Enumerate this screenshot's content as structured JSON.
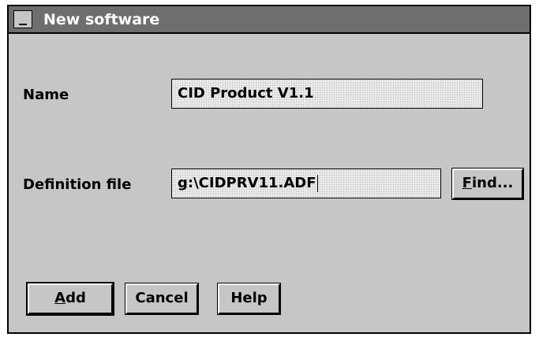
{
  "window": {
    "title": "New software",
    "sysmenu_glyph": "⌄"
  },
  "form": {
    "name_label": "Name",
    "name_value": "CID Product V1.1",
    "definition_label": "Definition file",
    "definition_value": "g:\\CIDPRV11.ADF"
  },
  "buttons": {
    "find_mnemonic": "F",
    "find_rest": "ind...",
    "add_mnemonic": "A",
    "add_rest": "dd",
    "cancel": "Cancel",
    "help": "Help"
  }
}
